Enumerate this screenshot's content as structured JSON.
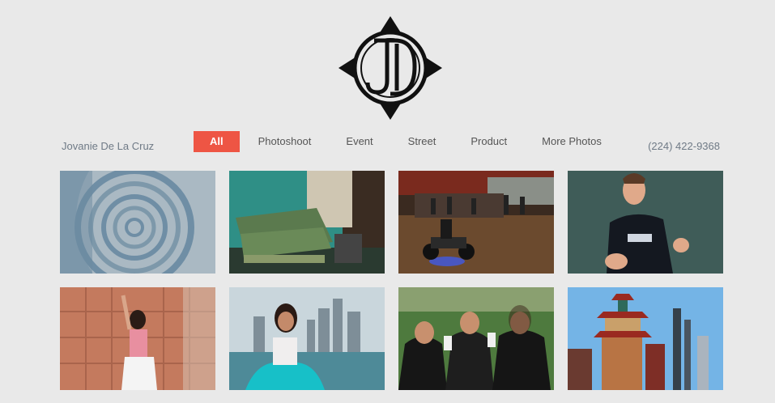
{
  "header": {
    "logo_icon": "jd-monogram-compass-logo",
    "owner_name": "Jovanie De La Cruz",
    "phone": "(224) 422-9368"
  },
  "filters": [
    {
      "label": "All",
      "active": true
    },
    {
      "label": "Photoshoot",
      "active": false
    },
    {
      "label": "Event",
      "active": false
    },
    {
      "label": "Street",
      "active": false
    },
    {
      "label": "Product",
      "active": false
    },
    {
      "label": "More Photos",
      "active": false
    }
  ],
  "colors": {
    "accent": "#ee5544",
    "background": "#e9e9e9",
    "nav_text": "#555555",
    "meta_text": "#6f7a86"
  }
}
